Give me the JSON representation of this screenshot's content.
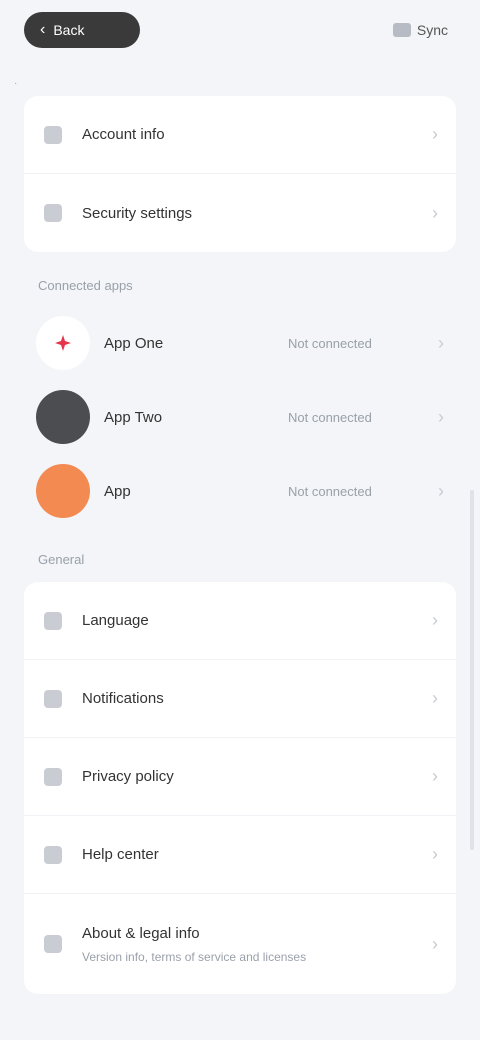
{
  "header": {
    "back_label": "Back",
    "action_label": "Sync",
    "caption": "·"
  },
  "top_group": {
    "items": [
      {
        "label": "Account info",
        "icon": "user-icon"
      },
      {
        "label": "Security settings",
        "icon": "shield-icon"
      }
    ]
  },
  "connected": {
    "title": "Connected apps",
    "apps": [
      {
        "name": "App One",
        "status": "Not connected",
        "logo_color": "#ffffff",
        "accent": "#e5334b"
      },
      {
        "name": "App Two",
        "status": "Not connected",
        "logo_color": "#4b4d51",
        "accent": "#4b4d51"
      },
      {
        "name": "App",
        "status": "Not connected",
        "logo_color": "#f28a52",
        "accent": "#f28a52"
      }
    ]
  },
  "general": {
    "title": "General",
    "items": [
      {
        "label": "Language",
        "icon": "globe-icon"
      },
      {
        "label": "Notifications",
        "icon": "bell-icon"
      },
      {
        "label": "Privacy policy",
        "icon": "lock-icon"
      },
      {
        "label": "Help center",
        "icon": "help-icon"
      }
    ],
    "last": {
      "title": "About & legal info",
      "subtitle": "Version info, terms of service and licenses",
      "icon": "info-icon"
    }
  }
}
